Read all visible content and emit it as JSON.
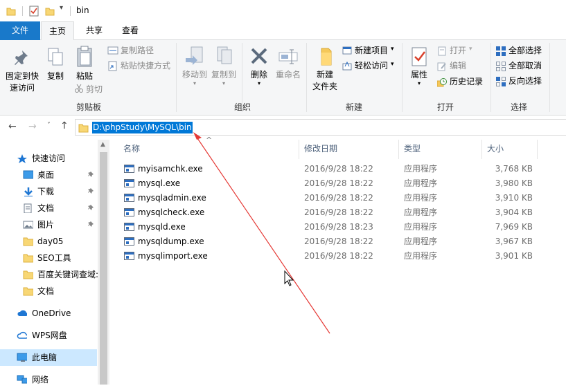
{
  "titlebar": {
    "title": "bin"
  },
  "tabs": {
    "file": "文件",
    "home": "主页",
    "share": "共享",
    "view": "查看"
  },
  "ribbon": {
    "clipboard": {
      "label": "剪贴板",
      "pin": "固定到快\n速访问",
      "pin_l1": "固定到快",
      "pin_l2": "速访问",
      "copy": "复制",
      "paste": "粘贴",
      "copy_path": "复制路径",
      "paste_shortcut": "粘贴快捷方式",
      "cut": "剪切"
    },
    "organize": {
      "label": "组织",
      "move_to": "移动到",
      "copy_to": "复制到",
      "delete": "删除",
      "rename": "重命名"
    },
    "new": {
      "label": "新建",
      "new_folder_l1": "新建",
      "new_folder_l2": "文件夹",
      "new_item": "新建项目",
      "easy_access": "轻松访问"
    },
    "open": {
      "label": "打开",
      "properties": "属性",
      "open": "打开",
      "edit": "编辑",
      "history": "历史记录"
    },
    "select": {
      "label": "选择",
      "select_all": "全部选择",
      "select_none": "全部取消",
      "invert": "反向选择"
    }
  },
  "address": {
    "path": "D:\\phpStudy\\MySQL\\bin"
  },
  "nav": {
    "items": [
      {
        "label": "快速访问",
        "icon": "star-icon"
      },
      {
        "label": "桌面",
        "icon": "desktop-icon"
      },
      {
        "label": "下载",
        "icon": "download-icon"
      },
      {
        "label": "文档",
        "icon": "document-icon"
      },
      {
        "label": "图片",
        "icon": "pictures-icon"
      },
      {
        "label": "day05",
        "icon": "folder-icon"
      },
      {
        "label": "SEO工具",
        "icon": "folder-icon"
      },
      {
        "label": "百度关键词查域:",
        "icon": "folder-icon"
      },
      {
        "label": "文档",
        "icon": "folder-icon"
      },
      {
        "label": "OneDrive",
        "icon": "cloud-icon"
      },
      {
        "label": "WPS网盘",
        "icon": "wps-cloud-icon"
      },
      {
        "label": "此电脑",
        "icon": "computer-icon"
      },
      {
        "label": "网络",
        "icon": "network-icon"
      }
    ]
  },
  "columns": {
    "name": "名称",
    "date": "修改日期",
    "type": "类型",
    "size": "大小"
  },
  "files": [
    {
      "name": "myisamchk.exe",
      "date": "2016/9/28 18:22",
      "type": "应用程序",
      "size": "3,768 KB"
    },
    {
      "name": "mysql.exe",
      "date": "2016/9/28 18:22",
      "type": "应用程序",
      "size": "3,980 KB"
    },
    {
      "name": "mysqladmin.exe",
      "date": "2016/9/28 18:22",
      "type": "应用程序",
      "size": "3,910 KB"
    },
    {
      "name": "mysqlcheck.exe",
      "date": "2016/9/28 18:22",
      "type": "应用程序",
      "size": "3,904 KB"
    },
    {
      "name": "mysqld.exe",
      "date": "2016/9/28 18:23",
      "type": "应用程序",
      "size": "7,969 KB"
    },
    {
      "name": "mysqldump.exe",
      "date": "2016/9/28 18:22",
      "type": "应用程序",
      "size": "3,967 KB"
    },
    {
      "name": "mysqlimport.exe",
      "date": "2016/9/28 18:22",
      "type": "应用程序",
      "size": "3,901 KB"
    }
  ],
  "colors": {
    "accent": "#0078d7",
    "file_tab": "#1979ca",
    "annotation_arrow": "#e53935"
  }
}
